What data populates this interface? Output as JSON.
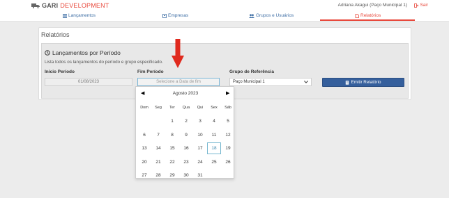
{
  "brand": {
    "part1": "GARI",
    "part2": "DEVELOPMENT",
    "icon": "truck-icon"
  },
  "user": {
    "name": "Adriana Akagui (Paço Municipal 1)",
    "logout": "Sair"
  },
  "nav": {
    "items": [
      {
        "label": "Lançamentos",
        "icon": "list-icon"
      },
      {
        "label": "Empresas",
        "icon": "building-icon"
      },
      {
        "label": "Grupos e Usuários",
        "icon": "users-icon"
      },
      {
        "label": "Relatórios",
        "icon": "file-icon"
      }
    ],
    "active": "Relatórios"
  },
  "page": {
    "title": "Relatórios"
  },
  "panel": {
    "title": "Lançamentos por Período",
    "description": "Lista todos os lançamentos do período e grupo especificado.",
    "start_label": "Início Período",
    "start_value": "01/08/2023",
    "end_label": "Fim Período",
    "end_placeholder": "Selecione a Data de fim",
    "group_label": "Grupo de Referência",
    "group_value": "Paço Municipal 1",
    "button_label": "Emitir Relatório"
  },
  "datepicker": {
    "prev": "◀",
    "next": "▶",
    "title": "Agosto 2023",
    "weekdays": [
      "Dom",
      "Seg",
      "Ter",
      "Qua",
      "Qui",
      "Sex",
      "Sáb"
    ],
    "weeks": [
      [
        "",
        "",
        "1",
        "2",
        "3",
        "4",
        "5"
      ],
      [
        "6",
        "7",
        "8",
        "9",
        "10",
        "11",
        "12"
      ],
      [
        "13",
        "14",
        "15",
        "16",
        "17",
        "18",
        "19"
      ],
      [
        "20",
        "21",
        "22",
        "23",
        "24",
        "25",
        "26"
      ],
      [
        "27",
        "28",
        "29",
        "30",
        "31",
        "",
        ""
      ]
    ],
    "today": "18"
  },
  "colors": {
    "accent": "#e8483b",
    "link": "#3f6fa5",
    "button": "#355f9c",
    "arrow": "#e02a1e"
  }
}
